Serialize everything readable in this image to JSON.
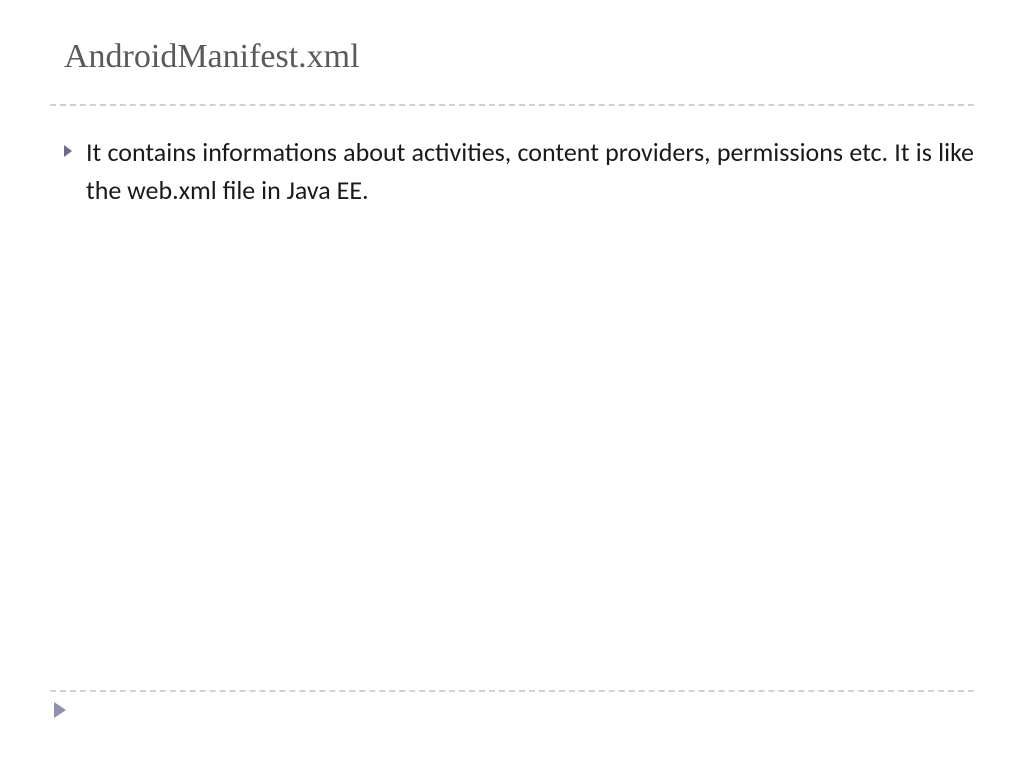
{
  "slide": {
    "title": "AndroidManifest.xml",
    "bullets": [
      "It contains informations about activities, content providers, permissions etc. It is like the web.xml file in Java EE."
    ]
  }
}
